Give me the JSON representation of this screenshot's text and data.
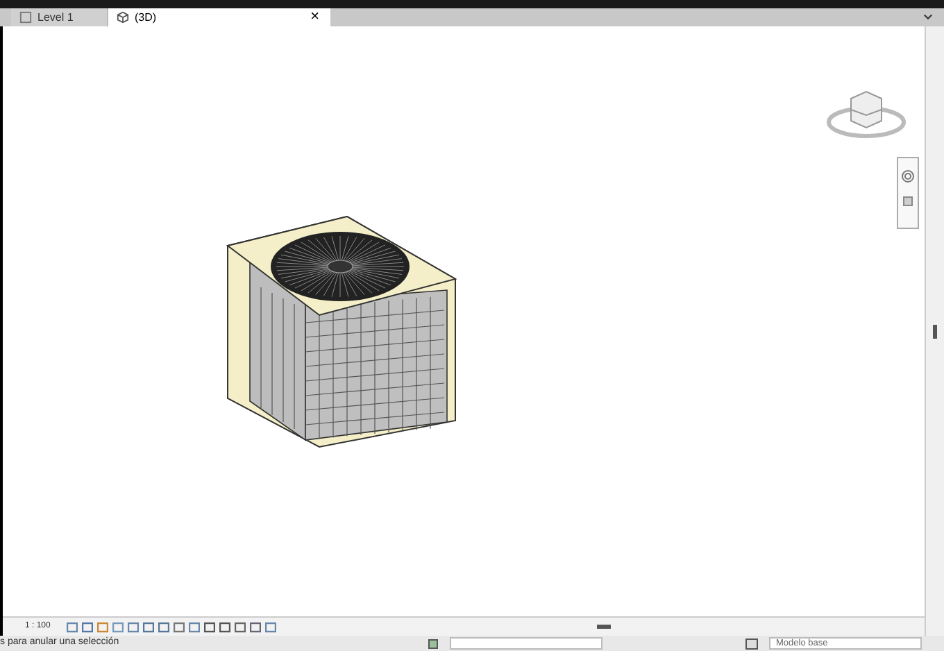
{
  "tabs": [
    {
      "label": "Level 1",
      "selected": false
    },
    {
      "label": "(3D)",
      "selected": true,
      "close": "×"
    }
  ],
  "view_bar": {
    "scale": "1 : 100"
  },
  "status_bar": {
    "message": "s para anular una selección",
    "model": "Modelo base"
  }
}
